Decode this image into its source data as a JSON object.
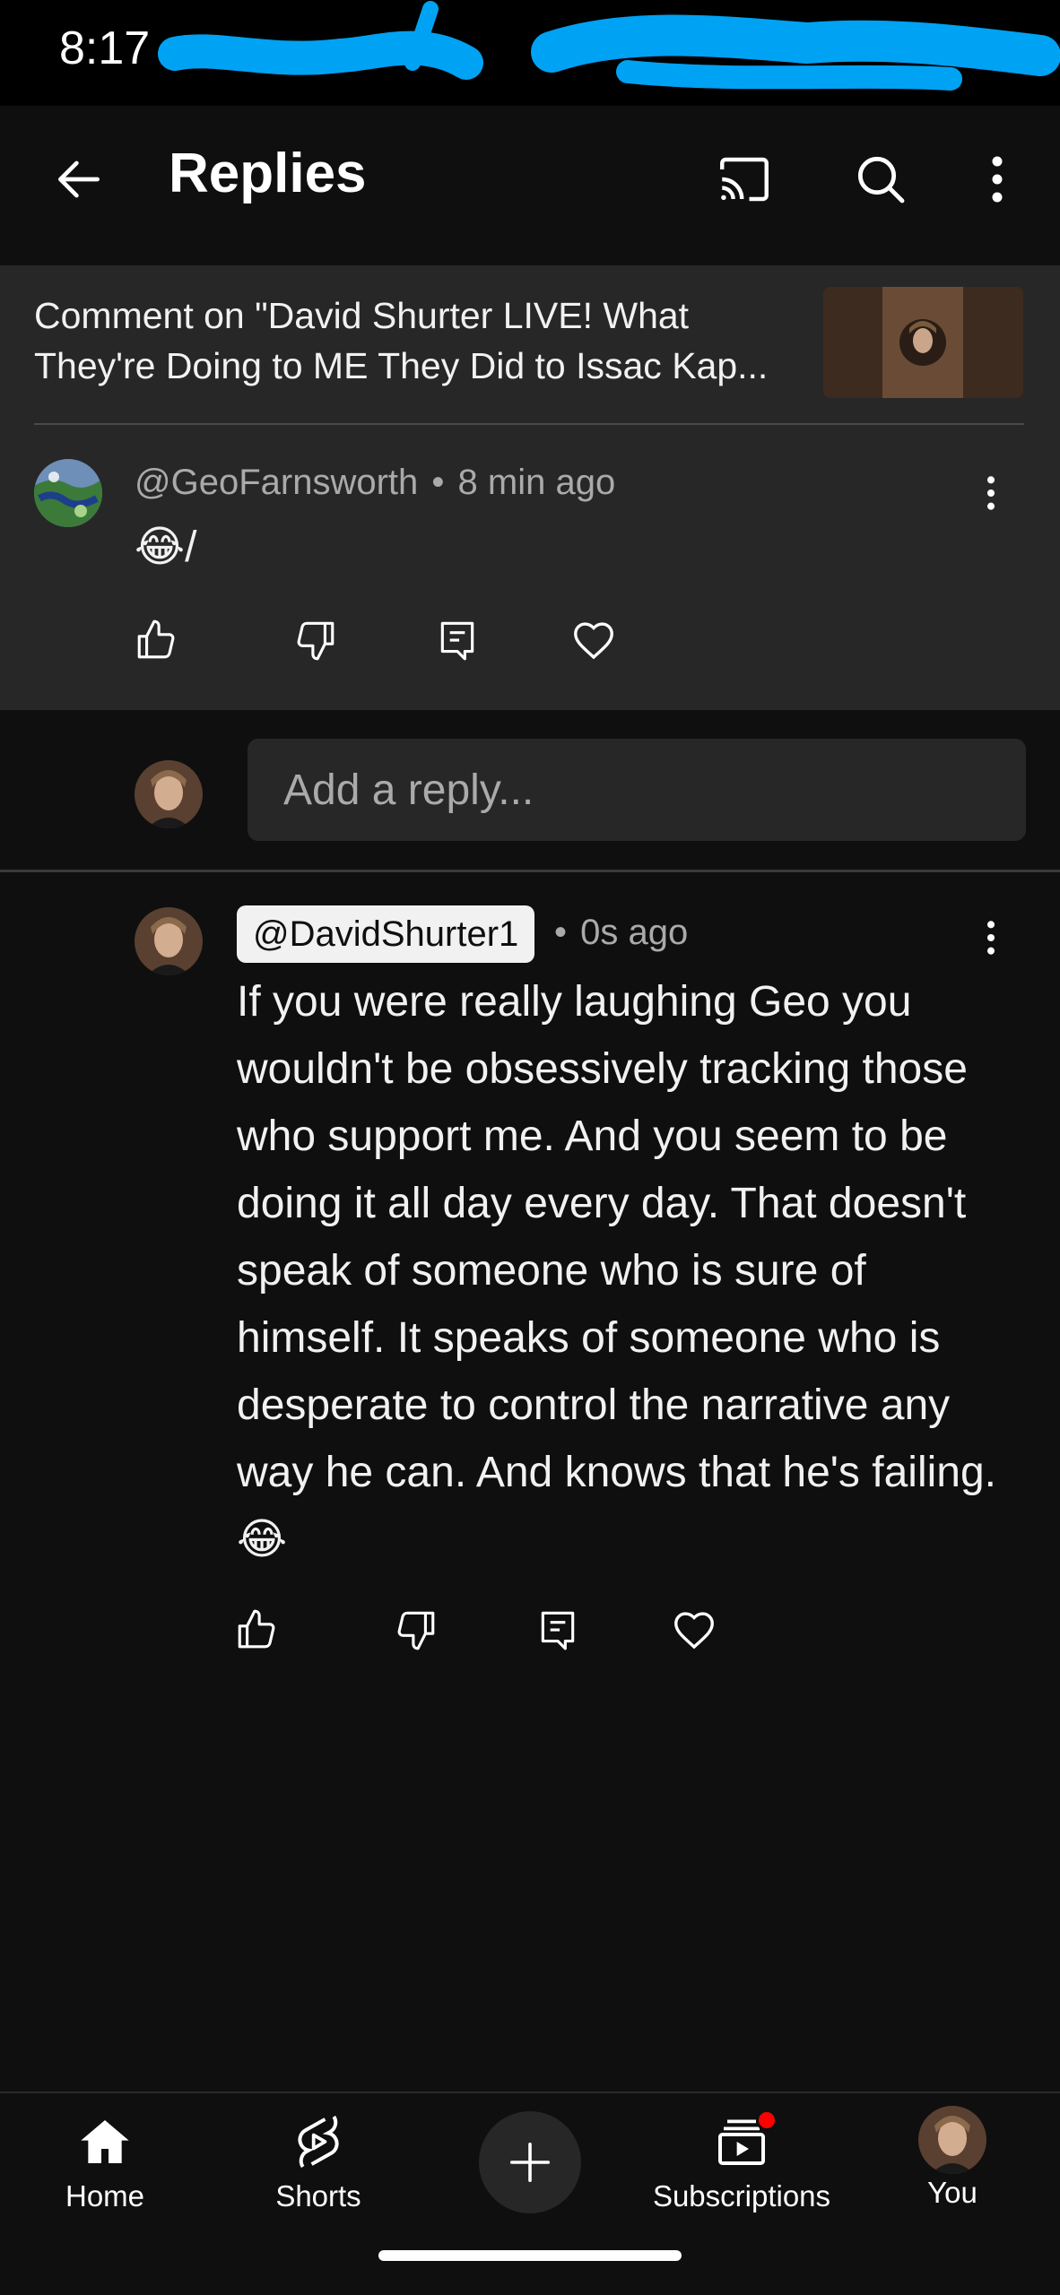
{
  "status_bar": {
    "time": "8:17"
  },
  "app_bar": {
    "title": "Replies",
    "icons": {
      "back": "back-arrow-icon",
      "cast": "cast-icon",
      "search": "search-icon",
      "more": "more-vert-icon"
    }
  },
  "context": {
    "text": "Comment on \"David Shurter LIVE! What They're Doing to ME They Did to Issac Kap..."
  },
  "parent_comment": {
    "handle": "@GeoFarnsworth",
    "time": "8 min ago",
    "text": "😂/"
  },
  "reply_box": {
    "placeholder": "Add a reply..."
  },
  "reply_comment": {
    "handle": "@DavidShurter1",
    "time": "0s ago",
    "text": "If you were really laughing Geo you wouldn't be obsessively tracking those who support me. And you seem to be doing it all day every day. That doesn't speak of someone who is sure of himself. It speaks of someone who is desperate to control the narrative any way he can. And knows that he's failing.😂"
  },
  "separator": "•",
  "bottom_nav": {
    "home": "Home",
    "shorts": "Shorts",
    "subscriptions": "Subscriptions",
    "you": "You"
  },
  "colors": {
    "background": "#0f0f0f",
    "surface": "#272727",
    "text_primary": "#f1f1f1",
    "text_secondary": "#aaaaaa",
    "notification_dot": "#ff0000",
    "redaction": "#00a2f4"
  }
}
